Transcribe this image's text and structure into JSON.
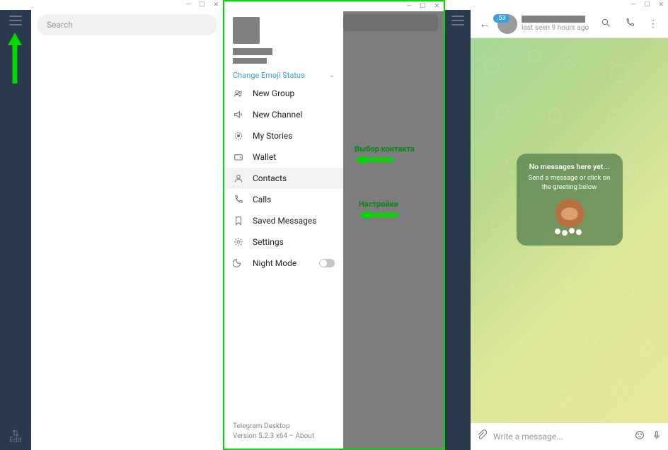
{
  "panel1": {
    "search_placeholder": "Search",
    "edit_label": "Edit"
  },
  "panel2": {
    "emoji_status": "Change Emoji Status",
    "menu": [
      {
        "label": "New Group",
        "icon": "group-icon"
      },
      {
        "label": "New Channel",
        "icon": "channel-icon"
      },
      {
        "label": "My Stories",
        "icon": "stories-icon"
      },
      {
        "label": "Wallet",
        "icon": "wallet-icon"
      },
      {
        "label": "Contacts",
        "icon": "contacts-icon"
      },
      {
        "label": "Calls",
        "icon": "calls-icon"
      },
      {
        "label": "Saved Messages",
        "icon": "bookmark-icon"
      },
      {
        "label": "Settings",
        "icon": "settings-icon"
      },
      {
        "label": "Night Mode",
        "icon": "night-icon"
      }
    ],
    "footer_app": "Telegram Desktop",
    "footer_version": "Version 5.2.3 x64 – About",
    "annotation_contacts": "Выбор контакта",
    "annotation_settings": "Настройки"
  },
  "panel3": {
    "badge": ".53",
    "last_seen": "last seen 9 hours ago",
    "empty_title": "No messages here yet...",
    "empty_sub": "Send a message or click on the greeting below",
    "input_placeholder": "Write a message..."
  }
}
